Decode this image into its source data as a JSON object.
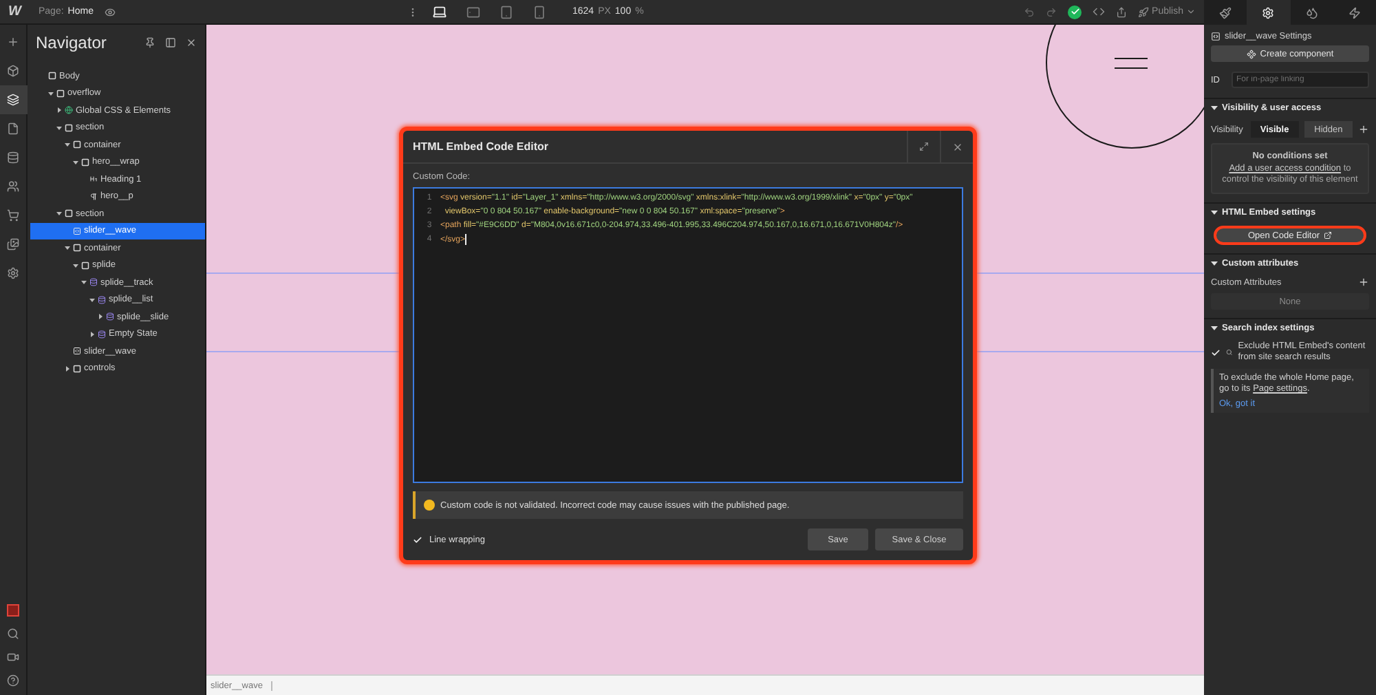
{
  "topbar": {
    "logo": "W",
    "page_label": "Page:",
    "page_name": "Home",
    "devices": [
      {
        "kind": "desktop",
        "selected": true
      },
      {
        "kind": "tablet-landscape",
        "selected": false
      },
      {
        "kind": "tablet",
        "selected": false
      },
      {
        "kind": "phone",
        "selected": false
      }
    ],
    "width_value": "1624",
    "width_unit": "PX",
    "zoom_value": "100",
    "zoom_unit": "%",
    "publish": "Publish"
  },
  "rail": [
    {
      "kind": "add",
      "selected": false
    },
    {
      "kind": "components",
      "selected": false
    },
    {
      "kind": "navigator",
      "selected": true
    },
    {
      "kind": "pages",
      "selected": false
    },
    {
      "kind": "cms",
      "selected": false
    },
    {
      "kind": "users",
      "selected": false
    },
    {
      "kind": "ecommerce",
      "selected": false
    },
    {
      "kind": "assets",
      "selected": false
    },
    {
      "kind": "settings",
      "selected": false
    }
  ],
  "rail_bottom": [
    {
      "kind": "record"
    },
    {
      "kind": "search"
    },
    {
      "kind": "video"
    },
    {
      "kind": "help"
    }
  ],
  "navigator": {
    "title": "Navigator",
    "tree": [
      {
        "label": "Body",
        "kind": "box",
        "collapsible": false,
        "selected": false,
        "children": [
          {
            "label": "overflow",
            "kind": "box",
            "collapsible": true,
            "expanded": true,
            "selected": false,
            "children": [
              {
                "label": "Global CSS & Elements",
                "kind": "globe",
                "collapsible": true,
                "expanded": false,
                "selected": false
              },
              {
                "label": "section",
                "kind": "box",
                "collapsible": true,
                "expanded": true,
                "selected": false,
                "children": [
                  {
                    "label": "container",
                    "kind": "box",
                    "collapsible": true,
                    "expanded": true,
                    "selected": false,
                    "children": [
                      {
                        "label": "hero__wrap",
                        "kind": "box",
                        "collapsible": true,
                        "expanded": true,
                        "selected": false,
                        "children": [
                          {
                            "label": "Heading 1",
                            "kind": "heading",
                            "collapsible": false,
                            "selected": false
                          },
                          {
                            "label": "hero__p",
                            "kind": "paragraph",
                            "collapsible": false,
                            "selected": false
                          }
                        ]
                      }
                    ]
                  }
                ]
              },
              {
                "label": "section",
                "kind": "box",
                "collapsible": true,
                "expanded": true,
                "selected": false,
                "children": [
                  {
                    "label": "slider__wave",
                    "kind": "embed",
                    "collapsible": false,
                    "selected": true
                  },
                  {
                    "label": "container",
                    "kind": "box",
                    "collapsible": true,
                    "expanded": true,
                    "selected": false,
                    "children": [
                      {
                        "label": "splide",
                        "kind": "box",
                        "collapsible": true,
                        "expanded": true,
                        "selected": false,
                        "children": [
                          {
                            "label": "splide__track",
                            "kind": "collection",
                            "collapsible": true,
                            "expanded": true,
                            "selected": false,
                            "children": [
                              {
                                "label": "splide__list",
                                "kind": "collection",
                                "collapsible": true,
                                "expanded": true,
                                "selected": false,
                                "children": [
                                  {
                                    "label": "splide__slide",
                                    "kind": "collection",
                                    "collapsible": true,
                                    "expanded": false,
                                    "selected": false
                                  }
                                ]
                              },
                              {
                                "label": "Empty State",
                                "kind": "collection",
                                "collapsible": true,
                                "expanded": false,
                                "selected": false
                              }
                            ]
                          }
                        ]
                      }
                    ]
                  },
                  {
                    "label": "slider__wave",
                    "kind": "embed",
                    "collapsible": false,
                    "selected": false
                  },
                  {
                    "label": "controls",
                    "kind": "box",
                    "collapsible": true,
                    "expanded": false,
                    "selected": false
                  }
                ]
              }
            ]
          }
        ]
      }
    ]
  },
  "canvas": {
    "breadcrumb": "slider__wave"
  },
  "modal": {
    "title": "HTML Embed Code Editor",
    "highlighted": true,
    "label": "Custom Code:",
    "lines": [
      {
        "number": "1",
        "tokens": [
          {
            "kind": "tag",
            "text": "<svg"
          },
          {
            "kind": "attr",
            "text": " version="
          },
          {
            "kind": "value",
            "text": "\"1.1\""
          },
          {
            "kind": "attr",
            "text": " id="
          },
          {
            "kind": "value",
            "text": "\"Layer_1\""
          },
          {
            "kind": "attr",
            "text": " xmlns="
          },
          {
            "kind": "value",
            "text": "\"http://www.w3.org/2000/svg\""
          },
          {
            "kind": "attr",
            "text": " xmlns:xlink="
          },
          {
            "kind": "value",
            "text": "\"http://www.w3.org/1999/xlink\""
          },
          {
            "kind": "attr",
            "text": " x="
          },
          {
            "kind": "value",
            "text": "\"0px\""
          },
          {
            "kind": "attr",
            "text": " y="
          },
          {
            "kind": "value",
            "text": "\"0px\""
          }
        ]
      },
      {
        "number": "2",
        "tokens": [
          {
            "kind": "attr",
            "text": "  viewBox="
          },
          {
            "kind": "value",
            "text": "\"0 0 804 50.167\""
          },
          {
            "kind": "attr",
            "text": " enable-background="
          },
          {
            "kind": "value",
            "text": "\"new 0 0 804 50.167\""
          },
          {
            "kind": "attr",
            "text": " xml:space="
          },
          {
            "kind": "value",
            "text": "\"preserve\""
          },
          {
            "kind": "tag",
            "text": ">"
          }
        ]
      },
      {
        "number": "3",
        "tokens": [
          {
            "kind": "tag",
            "text": "<path"
          },
          {
            "kind": "attr",
            "text": " fill="
          },
          {
            "kind": "value",
            "text": "\"#E9C6DD\""
          },
          {
            "kind": "attr",
            "text": " d="
          },
          {
            "kind": "value",
            "text": "\"M804,0v16.671c0,0-204.974,33.496-401.995,33.496C204.974,50.167,0,16.671,0,16.671V0H804z\""
          },
          {
            "kind": "tag",
            "text": "/>"
          }
        ]
      },
      {
        "number": "4",
        "tokens": [
          {
            "kind": "tag",
            "text": "</svg>"
          }
        ]
      }
    ],
    "warning": "Custom code is not validated. Incorrect code may cause issues with the published page.",
    "line_wrapping": {
      "label": "Line wrapping",
      "checked": true
    },
    "buttons": [
      "Save",
      "Save & Close"
    ]
  },
  "settings": {
    "tabs": [
      {
        "kind": "style",
        "selected": false
      },
      {
        "kind": "settings",
        "selected": true
      },
      {
        "kind": "interactions",
        "selected": false
      },
      {
        "kind": "lightning",
        "selected": false
      }
    ],
    "title": "slider__wave Settings",
    "create_button": "Create component",
    "id_label": "ID",
    "id_placeholder": "For in-page linking",
    "sections": [
      {
        "kind": "visibility",
        "title": "Visibility & user access",
        "expanded": true,
        "label": "Visibility",
        "options": [
          {
            "label": "Visible",
            "selected": true
          },
          {
            "label": "Hidden",
            "selected": false
          }
        ],
        "empty_title": "No conditions set",
        "empty_link": "Add a user access condition",
        "empty_text": " to control the visibility of this element"
      },
      {
        "kind": "embed",
        "title": "HTML Embed settings",
        "expanded": true,
        "button": "Open Code Editor",
        "highlighted": true
      },
      {
        "kind": "attributes",
        "title": "Custom attributes",
        "expanded": true,
        "label": "Custom Attributes",
        "empty": "None"
      },
      {
        "kind": "search",
        "title": "Search index settings",
        "expanded": true,
        "checkbox_label": "Exclude HTML Embed's content from site search results",
        "checked": true,
        "note": "To exclude the whole Home page, go to its ",
        "note_link": "Page settings",
        "note_end": ".",
        "dismiss": "Ok, got it"
      }
    ]
  }
}
